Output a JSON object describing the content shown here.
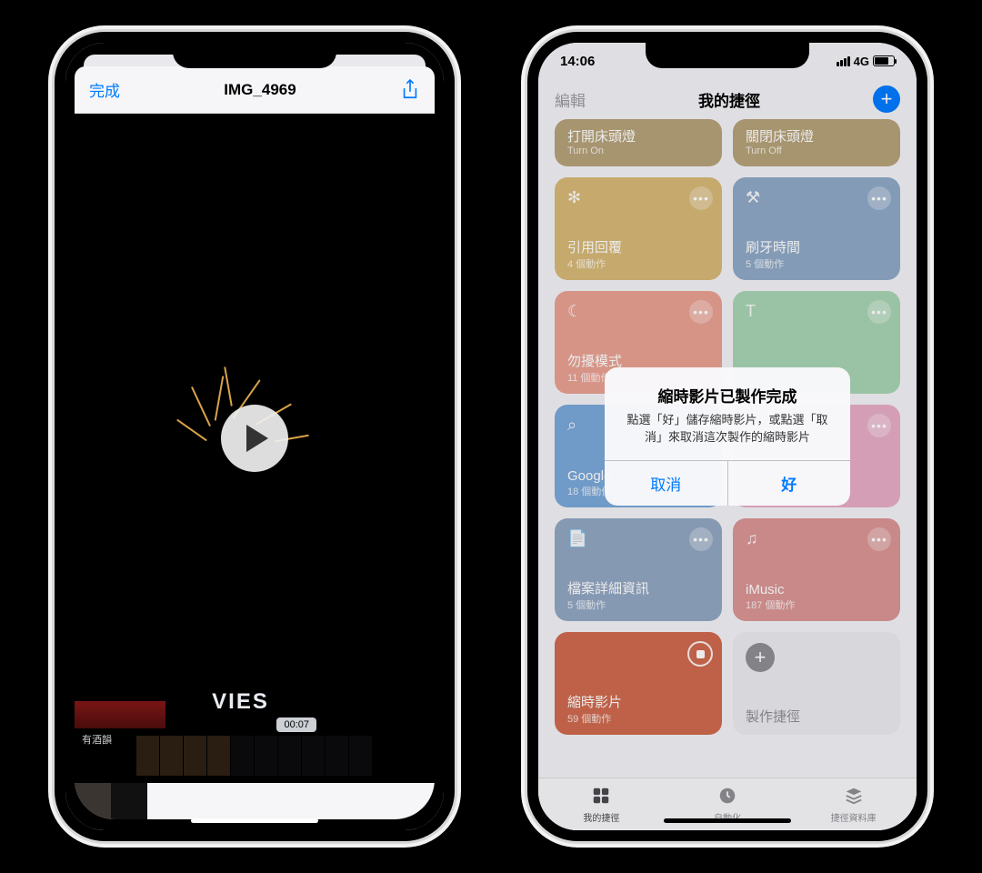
{
  "left_phone": {
    "nav": {
      "done": "完成",
      "title": "IMG_4969",
      "share_icon": "share-icon"
    },
    "video": {
      "timestamp": "00:07",
      "visible_text": "VIES",
      "banner_text": "有酒韻"
    }
  },
  "right_phone": {
    "status": {
      "time": "14:06",
      "network": "4G"
    },
    "nav": {
      "edit": "編輯",
      "title": "我的捷徑"
    },
    "tiles": [
      {
        "name": "打開床頭燈",
        "sub": "Turn On",
        "color": "#b6a27a",
        "short": true
      },
      {
        "name": "關閉床頭燈",
        "sub": "Turn Off",
        "color": "#b6a27a",
        "short": true
      },
      {
        "name": "引用回覆",
        "sub": "4 個動作",
        "color": "#d6b877",
        "icon": "✻"
      },
      {
        "name": "刷牙時間",
        "sub": "5 個動作",
        "color": "#8fa9c6",
        "icon": "⚒"
      },
      {
        "name": "勿擾模式",
        "sub": "11 個動作",
        "color": "#e9a193",
        "icon": "☾"
      },
      {
        "name": "",
        "sub": "",
        "color": "#a8d4b4",
        "icon": "T"
      },
      {
        "name": "Google",
        "sub": "18 個動作",
        "color": "#7aa8d8",
        "icon": "⌕"
      },
      {
        "name": "",
        "sub": "",
        "color": "#e6adc6",
        "icon": ""
      },
      {
        "name": "檔案詳細資訊",
        "sub": "5 個動作",
        "color": "#92a7c3",
        "icon": "📄"
      },
      {
        "name": "iMusic",
        "sub": "187 個動作",
        "color": "#d99594",
        "icon": "♫"
      },
      {
        "name": "縮時影片",
        "sub": "59 個動作",
        "color": "#cf6a4f",
        "icon": "",
        "running": true
      },
      {
        "name": "製作捷徑",
        "sub": "",
        "color": "addnew"
      }
    ],
    "alert": {
      "title": "縮時影片已製作完成",
      "message": "點選「好」儲存縮時影片，或點選「取消」來取消這次製作的縮時影片",
      "cancel": "取消",
      "ok": "好"
    },
    "tabs": [
      {
        "label": "我的捷徑",
        "active": true
      },
      {
        "label": "自動化",
        "active": false
      },
      {
        "label": "捷徑資料庫",
        "active": false
      }
    ]
  }
}
